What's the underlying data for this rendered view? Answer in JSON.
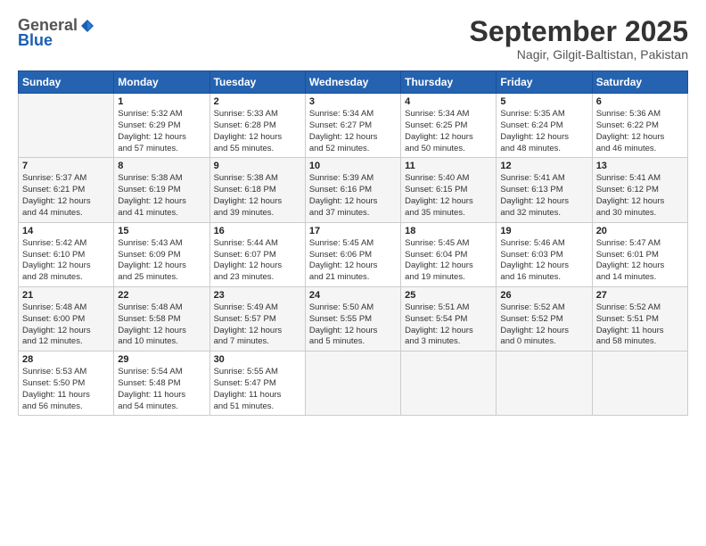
{
  "logo": {
    "general": "General",
    "blue": "Blue"
  },
  "header": {
    "month_year": "September 2025",
    "location": "Nagir, Gilgit-Baltistan, Pakistan"
  },
  "days_of_week": [
    "Sunday",
    "Monday",
    "Tuesday",
    "Wednesday",
    "Thursday",
    "Friday",
    "Saturday"
  ],
  "weeks": [
    [
      {
        "day": "",
        "info": ""
      },
      {
        "day": "1",
        "info": "Sunrise: 5:32 AM\nSunset: 6:29 PM\nDaylight: 12 hours\nand 57 minutes."
      },
      {
        "day": "2",
        "info": "Sunrise: 5:33 AM\nSunset: 6:28 PM\nDaylight: 12 hours\nand 55 minutes."
      },
      {
        "day": "3",
        "info": "Sunrise: 5:34 AM\nSunset: 6:27 PM\nDaylight: 12 hours\nand 52 minutes."
      },
      {
        "day": "4",
        "info": "Sunrise: 5:34 AM\nSunset: 6:25 PM\nDaylight: 12 hours\nand 50 minutes."
      },
      {
        "day": "5",
        "info": "Sunrise: 5:35 AM\nSunset: 6:24 PM\nDaylight: 12 hours\nand 48 minutes."
      },
      {
        "day": "6",
        "info": "Sunrise: 5:36 AM\nSunset: 6:22 PM\nDaylight: 12 hours\nand 46 minutes."
      }
    ],
    [
      {
        "day": "7",
        "info": "Sunrise: 5:37 AM\nSunset: 6:21 PM\nDaylight: 12 hours\nand 44 minutes."
      },
      {
        "day": "8",
        "info": "Sunrise: 5:38 AM\nSunset: 6:19 PM\nDaylight: 12 hours\nand 41 minutes."
      },
      {
        "day": "9",
        "info": "Sunrise: 5:38 AM\nSunset: 6:18 PM\nDaylight: 12 hours\nand 39 minutes."
      },
      {
        "day": "10",
        "info": "Sunrise: 5:39 AM\nSunset: 6:16 PM\nDaylight: 12 hours\nand 37 minutes."
      },
      {
        "day": "11",
        "info": "Sunrise: 5:40 AM\nSunset: 6:15 PM\nDaylight: 12 hours\nand 35 minutes."
      },
      {
        "day": "12",
        "info": "Sunrise: 5:41 AM\nSunset: 6:13 PM\nDaylight: 12 hours\nand 32 minutes."
      },
      {
        "day": "13",
        "info": "Sunrise: 5:41 AM\nSunset: 6:12 PM\nDaylight: 12 hours\nand 30 minutes."
      }
    ],
    [
      {
        "day": "14",
        "info": "Sunrise: 5:42 AM\nSunset: 6:10 PM\nDaylight: 12 hours\nand 28 minutes."
      },
      {
        "day": "15",
        "info": "Sunrise: 5:43 AM\nSunset: 6:09 PM\nDaylight: 12 hours\nand 25 minutes."
      },
      {
        "day": "16",
        "info": "Sunrise: 5:44 AM\nSunset: 6:07 PM\nDaylight: 12 hours\nand 23 minutes."
      },
      {
        "day": "17",
        "info": "Sunrise: 5:45 AM\nSunset: 6:06 PM\nDaylight: 12 hours\nand 21 minutes."
      },
      {
        "day": "18",
        "info": "Sunrise: 5:45 AM\nSunset: 6:04 PM\nDaylight: 12 hours\nand 19 minutes."
      },
      {
        "day": "19",
        "info": "Sunrise: 5:46 AM\nSunset: 6:03 PM\nDaylight: 12 hours\nand 16 minutes."
      },
      {
        "day": "20",
        "info": "Sunrise: 5:47 AM\nSunset: 6:01 PM\nDaylight: 12 hours\nand 14 minutes."
      }
    ],
    [
      {
        "day": "21",
        "info": "Sunrise: 5:48 AM\nSunset: 6:00 PM\nDaylight: 12 hours\nand 12 minutes."
      },
      {
        "day": "22",
        "info": "Sunrise: 5:48 AM\nSunset: 5:58 PM\nDaylight: 12 hours\nand 10 minutes."
      },
      {
        "day": "23",
        "info": "Sunrise: 5:49 AM\nSunset: 5:57 PM\nDaylight: 12 hours\nand 7 minutes."
      },
      {
        "day": "24",
        "info": "Sunrise: 5:50 AM\nSunset: 5:55 PM\nDaylight: 12 hours\nand 5 minutes."
      },
      {
        "day": "25",
        "info": "Sunrise: 5:51 AM\nSunset: 5:54 PM\nDaylight: 12 hours\nand 3 minutes."
      },
      {
        "day": "26",
        "info": "Sunrise: 5:52 AM\nSunset: 5:52 PM\nDaylight: 12 hours\nand 0 minutes."
      },
      {
        "day": "27",
        "info": "Sunrise: 5:52 AM\nSunset: 5:51 PM\nDaylight: 11 hours\nand 58 minutes."
      }
    ],
    [
      {
        "day": "28",
        "info": "Sunrise: 5:53 AM\nSunset: 5:50 PM\nDaylight: 11 hours\nand 56 minutes."
      },
      {
        "day": "29",
        "info": "Sunrise: 5:54 AM\nSunset: 5:48 PM\nDaylight: 11 hours\nand 54 minutes."
      },
      {
        "day": "30",
        "info": "Sunrise: 5:55 AM\nSunset: 5:47 PM\nDaylight: 11 hours\nand 51 minutes."
      },
      {
        "day": "",
        "info": ""
      },
      {
        "day": "",
        "info": ""
      },
      {
        "day": "",
        "info": ""
      },
      {
        "day": "",
        "info": ""
      }
    ]
  ]
}
